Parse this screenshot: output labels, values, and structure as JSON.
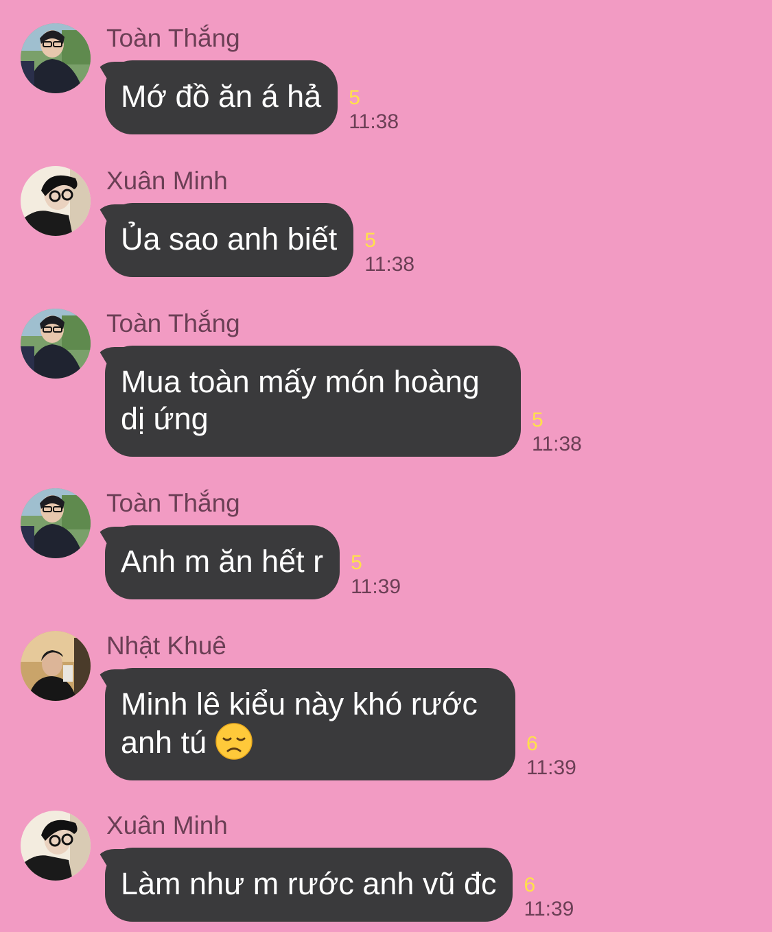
{
  "messages": [
    {
      "sender": "Toàn Thắng",
      "avatar": "toan-thang-avatar",
      "text": "Mớ đồ ăn á hả",
      "read_count": "5",
      "time": "11:38"
    },
    {
      "sender": "Xuân Minh",
      "avatar": "xuan-minh-avatar",
      "text": "Ủa sao anh biết",
      "read_count": "5",
      "time": "11:38"
    },
    {
      "sender": "Toàn Thắng",
      "avatar": "toan-thang-avatar",
      "text": "Mua toàn mấy món hoàng dị ứng",
      "read_count": "5",
      "time": "11:38"
    },
    {
      "sender": "Toàn Thắng",
      "avatar": "toan-thang-avatar",
      "text": "Anh m ăn hết r",
      "read_count": "5",
      "time": "11:39"
    },
    {
      "sender": "Nhật Khuê",
      "avatar": "nhat-khue-avatar",
      "text": "Minh lê kiểu này khó rước anh tú",
      "emoji": "disappointed-face-emoji",
      "read_count": "6",
      "time": "11:39"
    },
    {
      "sender": "Xuân Minh",
      "avatar": "xuan-minh-avatar",
      "text": "Làm như m rước anh vũ đc",
      "read_count": "6",
      "time": "11:39"
    }
  ],
  "colors": {
    "background": "#f29bc3",
    "bubble": "#3a3a3c",
    "bubble_text": "#ffffff",
    "read_count": "#ffe14a",
    "meta_text": "#6b3f55"
  }
}
